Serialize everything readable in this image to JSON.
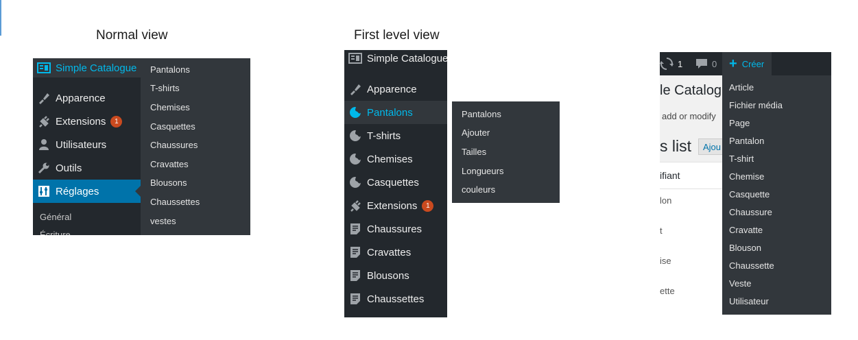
{
  "headings": {
    "normal": "Normal view",
    "first_level": "First level view"
  },
  "normal_view": {
    "menu": {
      "plugin": "Simple Catalogue",
      "apparence": "Apparence",
      "extensions": "Extensions",
      "extensions_badge": "1",
      "utilisateurs": "Utilisateurs",
      "outils": "Outils",
      "reglages": "Réglages",
      "sub_general": "Général",
      "sub_ecriture": "Écriture"
    },
    "flyout": [
      "Pantalons",
      "T-shirts",
      "Chemises",
      "Casquettes",
      "Chaussures",
      "Cravattes",
      "Blousons",
      "Chaussettes",
      "vestes"
    ]
  },
  "first_level_view": {
    "menu": {
      "plugin": "Simple Catalogue",
      "apparence": "Apparence",
      "pantalons": "Pantalons",
      "tshirts": "T-shirts",
      "chemises": "Chemises",
      "casquettes": "Casquettes",
      "extensions": "Extensions",
      "extensions_badge": "1",
      "chaussures": "Chaussures",
      "cravattes": "Cravattes",
      "blousons": "Blousons",
      "chaussettes": "Chaussettes"
    },
    "flyout": [
      "Pantalons",
      "Ajouter",
      "Tailles",
      "Longueurs",
      "couleurs"
    ]
  },
  "admin_bar_view": {
    "updates_count": "1",
    "comments_count": "0",
    "create_label": "Créer",
    "page_title": "le Catalogue",
    "page_subtitle": "add or modify",
    "list_title": "s list",
    "add_button": "Ajou",
    "column_header": "ifiant",
    "rows": [
      "lon",
      "t",
      "ise",
      "ette"
    ],
    "dropdown": [
      "Article",
      "Fichier média",
      "Page",
      "Pantalon",
      "T-shirt",
      "Chemise",
      "Casquette",
      "Chaussure",
      "Cravatte",
      "Blouson",
      "Chaussette",
      "Veste",
      "Utilisateur"
    ]
  },
  "colors": {
    "menu_bg": "#23282d",
    "submenu_bg": "#32373c",
    "active_blue": "#0073aa",
    "highlight_blue": "#00b9eb",
    "badge": "#ca4a1f"
  }
}
